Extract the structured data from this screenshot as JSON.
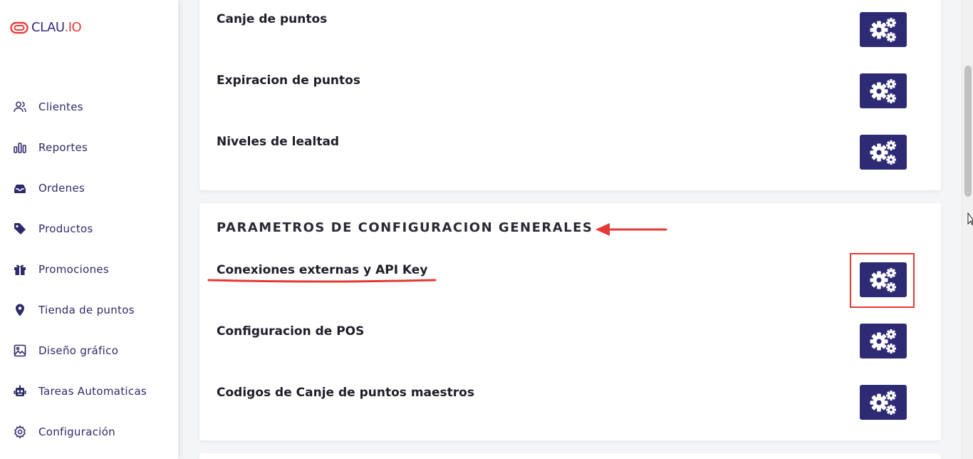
{
  "brand": {
    "logo_part1": "CLAU",
    "logo_dot": ".",
    "logo_part2": "IO"
  },
  "sidebar": {
    "items": [
      {
        "label": "Clientes",
        "icon": "users-icon"
      },
      {
        "label": "Reportes",
        "icon": "bar-chart-icon"
      },
      {
        "label": "Ordenes",
        "icon": "inbox-icon"
      },
      {
        "label": "Productos",
        "icon": "tag-icon"
      },
      {
        "label": "Promociones",
        "icon": "gift-icon"
      },
      {
        "label": "Tienda de puntos",
        "icon": "map-pin-icon"
      },
      {
        "label": "Diseño gráfico",
        "icon": "image-icon"
      },
      {
        "label": "Tareas Automaticas",
        "icon": "robot-icon"
      },
      {
        "label": "Configuración",
        "icon": "gear-icon"
      }
    ]
  },
  "points_card": {
    "rows": [
      {
        "label": "Canje de puntos"
      },
      {
        "label": "Expiracion de puntos"
      },
      {
        "label": "Niveles de lealtad"
      }
    ]
  },
  "general_card": {
    "title": "PARAMETROS DE CONFIGURACION GENERALES",
    "rows": [
      {
        "label": "Conexiones externas y API Key"
      },
      {
        "label": "Configuracion de POS"
      },
      {
        "label": "Codigos de Canje de puntos maestros"
      }
    ]
  },
  "colors": {
    "accent": "#2e2b74",
    "sidebar_text": "#2e2a6a",
    "annotation": "#e53935",
    "brand_red": "#e63b3b"
  }
}
